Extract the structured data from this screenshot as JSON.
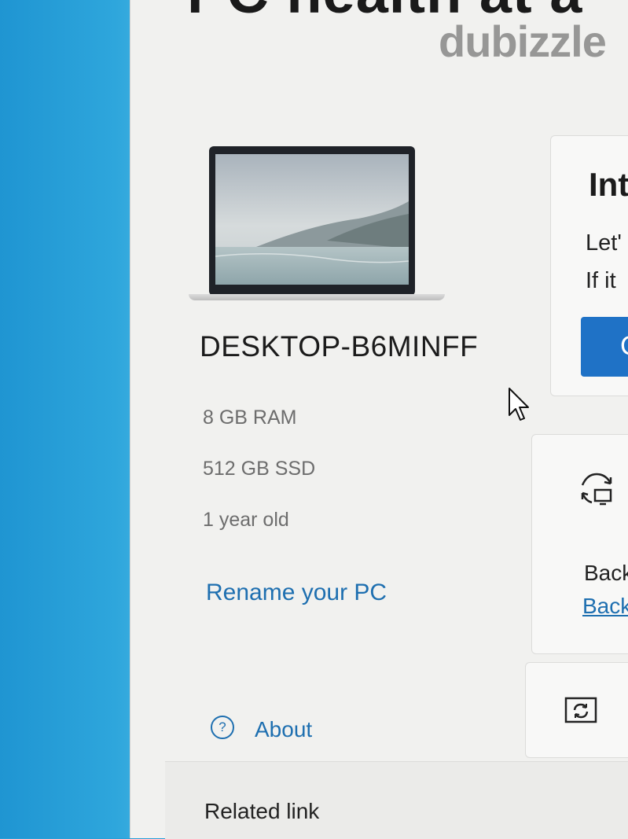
{
  "header": {
    "title_cut": "PC health at a",
    "watermark": "dubizzle"
  },
  "device": {
    "name": "DESKTOP-B6MINFF",
    "specs": [
      "8 GB RAM",
      "512 GB SSD",
      "1 year old"
    ],
    "rename_link": "Rename your PC"
  },
  "sidebar_links": {
    "about": "About",
    "about_icon": "question-circle-icon",
    "related": "Related link"
  },
  "cards": {
    "intro": {
      "title": "Int",
      "line1": "Let'",
      "line2": "If it",
      "button_label": "C"
    },
    "backup": {
      "icon": "sync-backup-icon",
      "text": "Back",
      "link": "Back"
    },
    "update": {
      "icon": "refresh-icon"
    }
  },
  "colors": {
    "accent": "#1f72c6",
    "link": "#1e6fb0",
    "desktop": "#2b9fd8"
  }
}
